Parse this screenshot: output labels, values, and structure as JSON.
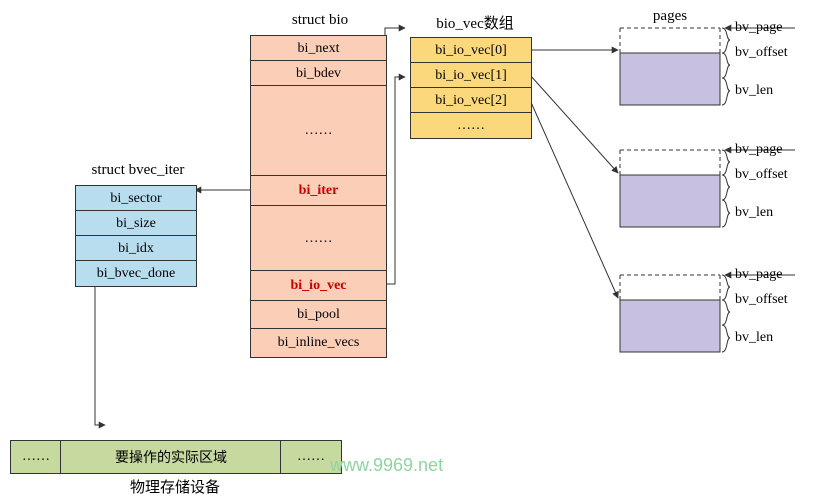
{
  "titles": {
    "struct_bio": "struct bio",
    "struct_bvec_iter": "struct bvec_iter",
    "bio_vec_array": "bio_vec数组",
    "pages": "pages"
  },
  "bio_fields": {
    "bi_next": "bi_next",
    "bi_bdev": "bi_bdev",
    "ellipsis1": "……",
    "bi_iter": "bi_iter",
    "ellipsis2": "……",
    "bi_io_vec": "bi_io_vec",
    "bi_pool": "bi_pool",
    "bi_inline_vecs": "bi_inline_vecs"
  },
  "bvec_iter_fields": {
    "bi_sector": "bi_sector",
    "bi_size": "bi_size",
    "bi_idx": "bi_idx",
    "bi_bvec_done": "bi_bvec_done"
  },
  "bio_vec_array_fields": {
    "v0": "bi_io_vec[0]",
    "v1": "bi_io_vec[1]",
    "v2": "bi_io_vec[2]",
    "ellipsis": "……"
  },
  "page_labels": {
    "bv_page": "bv_page",
    "bv_offset": "bv_offset",
    "bv_len": "bv_len"
  },
  "storage": {
    "ellipsis_left": "……",
    "region": "要操作的实际区域",
    "ellipsis_right": "……",
    "caption": "物理存储设备"
  },
  "watermark": "www.9969.net"
}
